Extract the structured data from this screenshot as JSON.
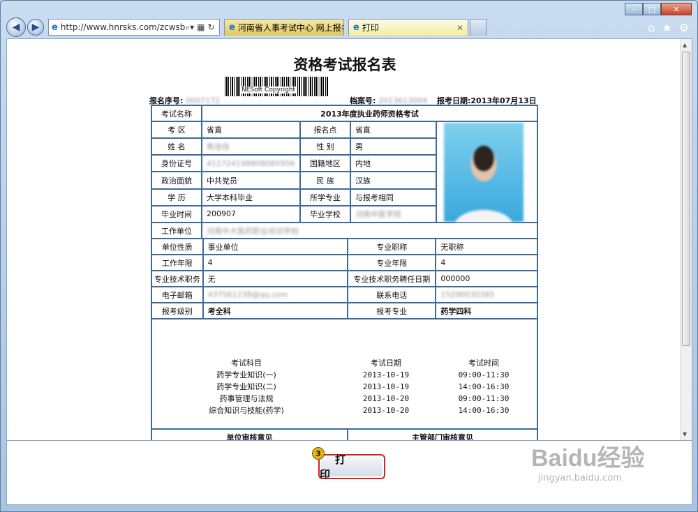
{
  "browser": {
    "address": "http://www.hnrsks.com/zcwsb",
    "tabs": [
      {
        "label": "河南省人事考试中心 网上报名..."
      },
      {
        "label": "打印"
      }
    ]
  },
  "doc": {
    "title": "资格考试报名表",
    "reg_no_label": "报名序号:",
    "reg_no_value": "0007172",
    "barcode_text": "NESoft Copyright",
    "archive_label": "档案号:",
    "archive_value": "2013613004",
    "date_label": "报考日期:",
    "date_value": "2013年07月13日"
  },
  "form": {
    "exam_name_label": "考试名称",
    "exam_name_value": "2013年度执业药师资格考试",
    "district_label": "考  区",
    "district_value": "省直",
    "site_label": "报名点",
    "site_value": "省直",
    "name_label": "姓  名",
    "name_value": "焦佳佳",
    "gender_label": "性  别",
    "gender_value": "男",
    "id_label": "身份证号",
    "id_value": "41272419880808X956",
    "region_label": "国籍地区",
    "region_value": "内地",
    "political_label": "政治面貌",
    "political_value": "中共党员",
    "ethnic_label": "民  族",
    "ethnic_value": "汉族",
    "edu_label": "学  历",
    "edu_value": "大学本科毕业",
    "major_label": "所学专业",
    "major_value": "与报考相同",
    "grad_time_label": "毕业时间",
    "grad_time_value": "200907",
    "school_label": "毕业学校",
    "school_value": "河南中医学院",
    "work_unit_label": "工作单位",
    "work_unit_value": "河南中大医药职业培训学校",
    "unit_type_label": "单位性质",
    "unit_type_value": "事业单位",
    "title_label": "专业职称",
    "title_value": "无职称",
    "work_years_label": "工作年限",
    "work_years_value": "4",
    "major_years_label": "专业年限",
    "major_years_value": "4",
    "tech_post_label": "专业技术职务",
    "tech_post_value": "无",
    "tech_date_label": "专业技术职务聘任日期",
    "tech_date_value": "000000",
    "email_label": "电子邮箱",
    "email_value": "437561238@qq.com",
    "phone_label": "联系电话",
    "phone_value": "15290030385",
    "level_label": "报考级别",
    "level_value": "考全科",
    "apply_major_label": "报考专业",
    "apply_major_value": "药学四科",
    "unit_review_label": "单位审核意见",
    "dept_review_label": "主管部门审核意见"
  },
  "subjects": {
    "headers": [
      "考试科目",
      "考试日期",
      "考试时间"
    ],
    "rows": [
      [
        "药学专业知识(一)",
        "2013-10-19",
        "09:00-11:30"
      ],
      [
        "药学专业知识(二)",
        "2013-10-19",
        "14:00-16:30"
      ],
      [
        "药事管理与法规",
        "2013-10-20",
        "09:00-11:30"
      ],
      [
        "综合知识与技能(药学)",
        "2013-10-20",
        "14:00-16:30"
      ]
    ]
  },
  "print_button": {
    "label": "打印",
    "badge": "3"
  },
  "watermark": {
    "logo": "Baidu经验",
    "url": "jingyan.baidu.com"
  }
}
